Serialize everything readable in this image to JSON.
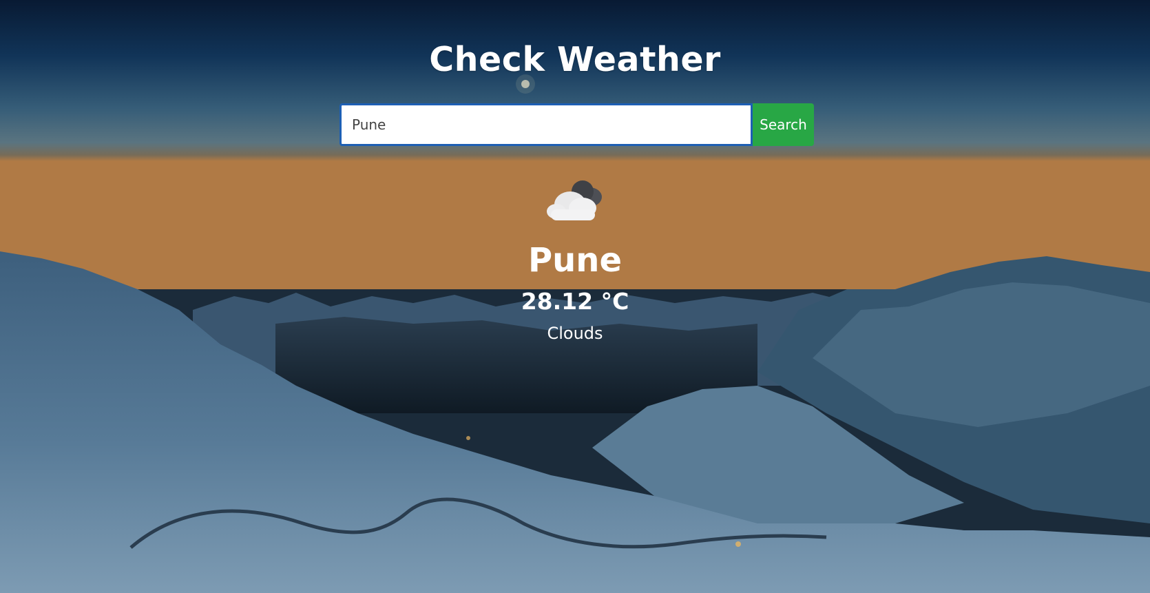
{
  "page": {
    "title": "Check Weather"
  },
  "search": {
    "value": "Pune",
    "placeholder": "",
    "button_label": "Search"
  },
  "weather": {
    "icon": "clouds-icon",
    "city": "Pune",
    "temperature": "28.12 °C",
    "condition": "Clouds"
  },
  "colors": {
    "accent": "#28a745",
    "input_border": "#1d5fb4",
    "text": "#ffffff"
  }
}
